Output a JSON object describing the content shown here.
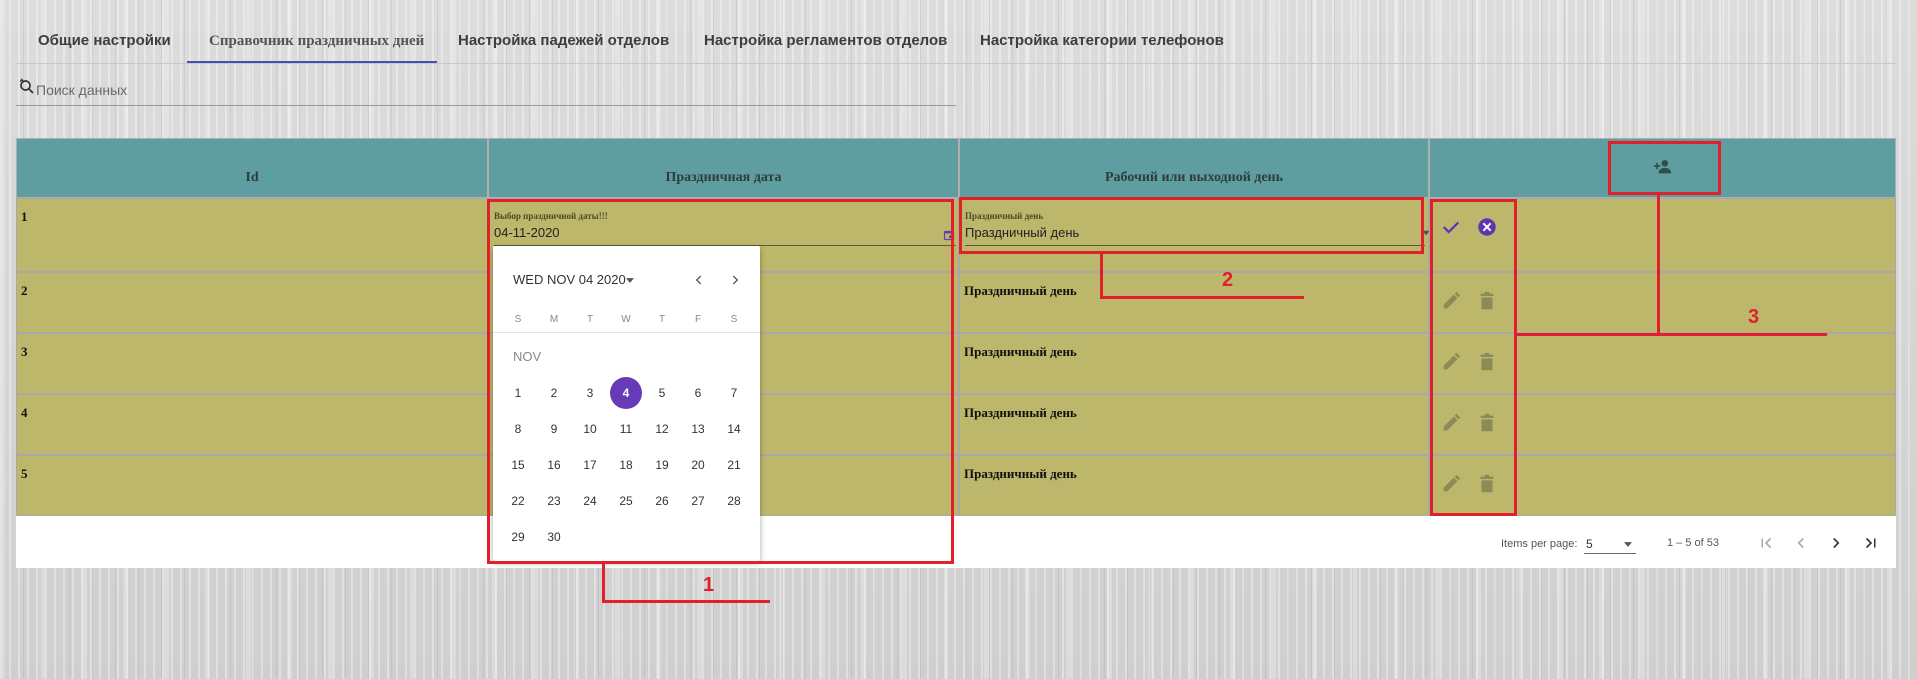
{
  "tabs": [
    {
      "label": "Общие настройки"
    },
    {
      "label": "Справочник праздничных дней"
    },
    {
      "label": "Настройка падежей отделов"
    },
    {
      "label": "Настройка регламентов отделов"
    },
    {
      "label": "Настройка категории телефонов"
    }
  ],
  "search": {
    "placeholder": "Поиск данных",
    "icon": "search-refresh-icon"
  },
  "table": {
    "headers": [
      "Id",
      "Праздничная дата",
      "Рабочий или выходной день"
    ],
    "add_icon": "add-user-icon",
    "editing_row": {
      "id": "1",
      "date_label": "Выбор праздничной даты!!!",
      "date_value": "04-11-2020",
      "type_label": "Праздничный день",
      "type_value": "Праздничный день",
      "confirm_icon": "check-icon",
      "cancel_icon": "cancel-circle-icon"
    },
    "rows": [
      {
        "id": "2",
        "type": "Праздничный день"
      },
      {
        "id": "3",
        "type": "Праздничный день"
      },
      {
        "id": "4",
        "type": "Праздничный день"
      },
      {
        "id": "5",
        "type": "Праздничный день"
      }
    ],
    "row_icons": [
      "edit-pencil-icon",
      "delete-trash-icon"
    ]
  },
  "pagination": {
    "items_per_page_label": "Items per page:",
    "items_per_page_value": "5",
    "range": "1 – 5 of 53"
  },
  "calendar": {
    "header": "WED NOV 04 2020",
    "weekdays": [
      "S",
      "M",
      "T",
      "W",
      "T",
      "F",
      "S"
    ],
    "month_label": "NOV",
    "days": [
      "1",
      "2",
      "3",
      "4",
      "5",
      "6",
      "7",
      "8",
      "9",
      "10",
      "11",
      "12",
      "13",
      "14",
      "15",
      "16",
      "17",
      "18",
      "19",
      "20",
      "21",
      "22",
      "23",
      "24",
      "25",
      "26",
      "27",
      "28",
      "29",
      "30"
    ],
    "selected_day": "4"
  },
  "annotations": [
    "1",
    "2",
    "3"
  ],
  "colors": {
    "header_bg": "#5f9ea0",
    "row_bg": "#bdb76b",
    "accent": "#673ab7",
    "annotation_red": "#e0202a"
  }
}
